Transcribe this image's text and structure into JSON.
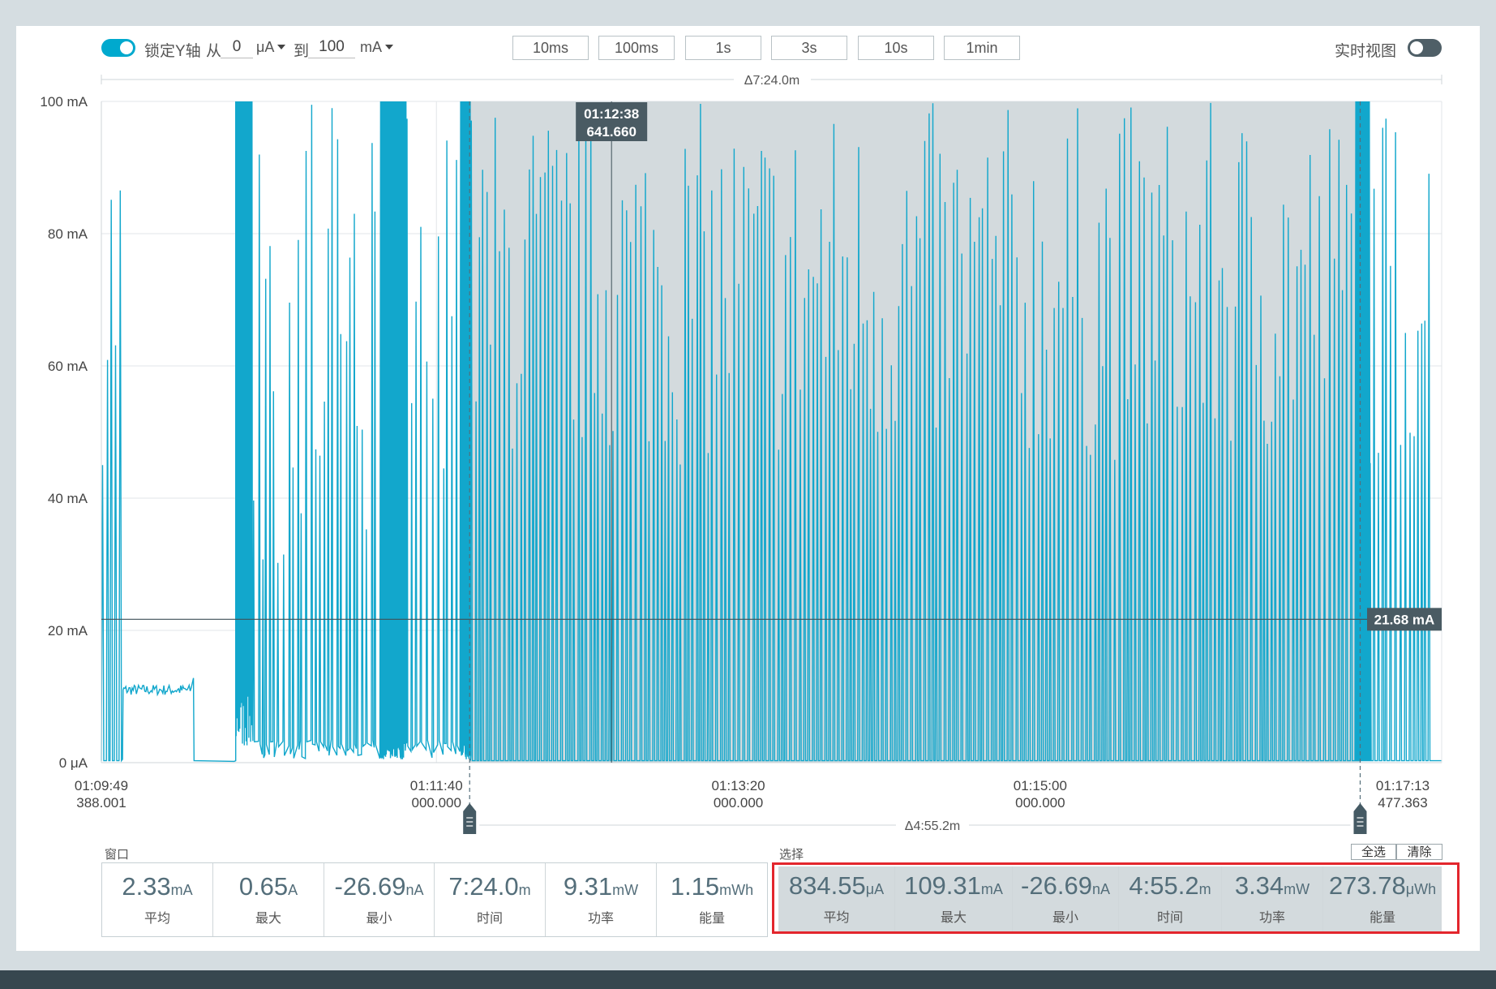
{
  "toolbar": {
    "lock_y_label": "锁定Y轴",
    "from_label": "从",
    "to_label": "到",
    "y_min": "0",
    "y_min_unit": "μA",
    "y_max": "100",
    "y_max_unit": "mA",
    "time_windows": [
      "10ms",
      "100ms",
      "1s",
      "3s",
      "10s",
      "1min"
    ],
    "realtime_label": "实时视图"
  },
  "colors": {
    "accent": "#00a9ce",
    "trace": "#12a7cc",
    "selection_fill": "#d3dadd",
    "tooltip_bg": "#4a5b63",
    "highlight_border": "#e3262d"
  },
  "chart_data": {
    "type": "line",
    "ylabel_ticks": [
      "100 mA",
      "80 mA",
      "60 mA",
      "40 mA",
      "20 mA",
      "0 μA"
    ],
    "ylim": [
      0,
      100
    ],
    "y_unit": "mA",
    "x_ticks": [
      {
        "time": "01:09:49",
        "sub": "388.001"
      },
      {
        "time": "01:11:40",
        "sub": "000.000"
      },
      {
        "time": "01:13:20",
        "sub": "000.000"
      },
      {
        "time": "01:15:00",
        "sub": "000.000"
      },
      {
        "time": "01:17:13",
        "sub": "477.363"
      }
    ],
    "xlim_seconds": [
      0,
      444
    ],
    "window_delta": "Δ7:24.0m",
    "selection_delta": "Δ4:55.2m",
    "selection_seconds": [
      122,
      417
    ],
    "cursor": {
      "time": "01:12:38",
      "sub": "641.660",
      "seconds": 169
    },
    "reference_line": {
      "value": 21.68,
      "label": "21.68 mA"
    },
    "grid": true,
    "trace_description": "Current trace with frequent spikes up to ~100 mA, a flat ~11 mA plateau between 01:09:56 and 01:10:14, near-zero idle until 01:10:33, then periodic bursts"
  },
  "window_stats": {
    "title": "窗口",
    "cells": [
      {
        "value": "2.33",
        "unit": "mA",
        "label": "平均"
      },
      {
        "value": "0.65",
        "unit": "A",
        "label": "最大"
      },
      {
        "value": "-26.69",
        "unit": "nA",
        "label": "最小"
      },
      {
        "value": "7:24.0",
        "unit": "m",
        "label": "时间"
      },
      {
        "value": "9.31",
        "unit": "mW",
        "label": "功率"
      },
      {
        "value": "1.15",
        "unit": "mWh",
        "label": "能量"
      }
    ]
  },
  "selection_stats": {
    "title": "选择",
    "select_all_label": "全选",
    "clear_label": "清除",
    "cells": [
      {
        "value": "834.55",
        "unit": "μA",
        "label": "平均"
      },
      {
        "value": "109.31",
        "unit": "mA",
        "label": "最大"
      },
      {
        "value": "-26.69",
        "unit": "nA",
        "label": "最小"
      },
      {
        "value": "4:55.2",
        "unit": "m",
        "label": "时间"
      },
      {
        "value": "3.34",
        "unit": "mW",
        "label": "功率"
      },
      {
        "value": "273.78",
        "unit": "μWh",
        "label": "能量"
      }
    ]
  }
}
